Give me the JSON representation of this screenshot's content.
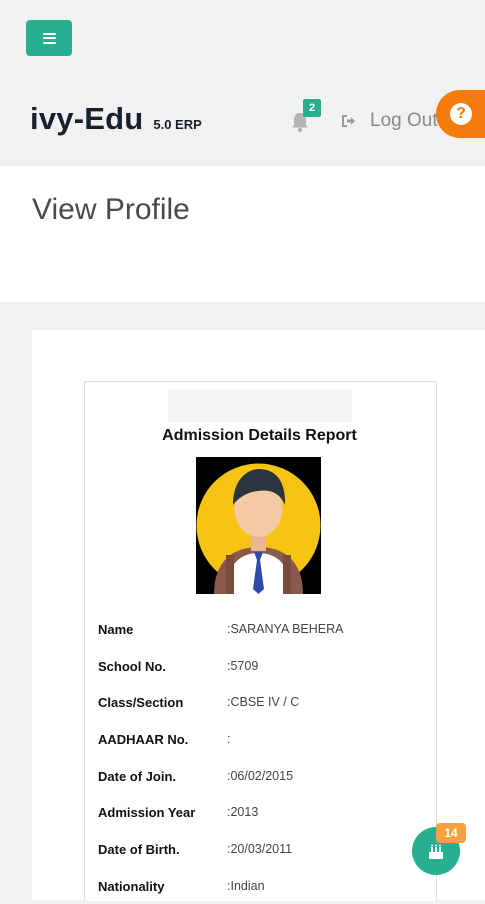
{
  "header": {
    "brand_name": "ivy-Edu",
    "brand_version": "5.0 ERP",
    "notification_count": "2",
    "logout_label": "Log Out",
    "help_glyph": "?"
  },
  "page": {
    "title": "View Profile"
  },
  "report": {
    "title": "Admission Details Report",
    "fields": [
      {
        "label": "Name",
        "value": ":SARANYA BEHERA"
      },
      {
        "label": "School No.",
        "value": ":5709"
      },
      {
        "label": "Class/Section",
        "value": ":CBSE   IV / C"
      },
      {
        "label": "AADHAAR No.",
        "value": ":"
      },
      {
        "label": "Date of Join.",
        "value": ":06/02/2015"
      },
      {
        "label": "Admission Year",
        "value": ":2013"
      },
      {
        "label": "Date of Birth.",
        "value": ":20/03/2011"
      },
      {
        "label": "Nationality",
        "value": ":Indian"
      }
    ]
  },
  "floating": {
    "badge_count": "14"
  },
  "colors": {
    "accent": "#26b08f",
    "help": "#f47c0c",
    "badge": "#f7a23c"
  },
  "icons": {
    "menu": "menu-icon",
    "bell": "bell-icon",
    "logout": "logout-icon",
    "help": "question-icon",
    "cake": "cake-icon",
    "avatar": "student-avatar"
  }
}
